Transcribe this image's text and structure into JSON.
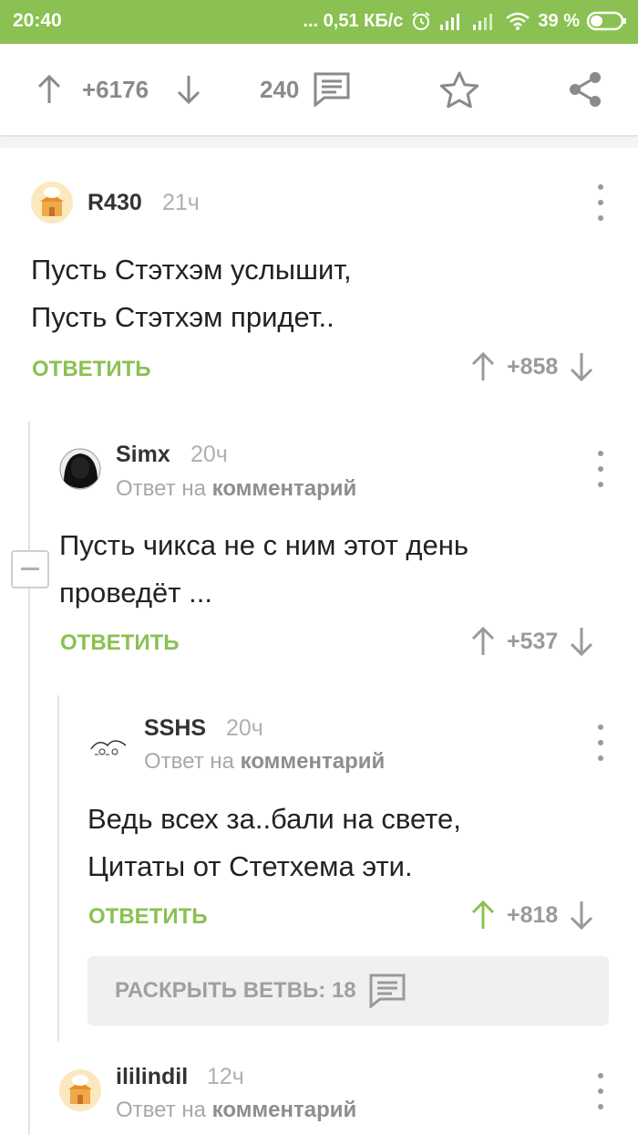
{
  "status_bar": {
    "time": "20:40",
    "network": "... 0,51 КБ/с",
    "battery": "39 %",
    "icons": [
      "alarm-icon",
      "signal-icon",
      "signal-icon",
      "wifi-icon",
      "battery-icon"
    ]
  },
  "post_toolbar": {
    "rating": "+6176",
    "comments_count": "240",
    "icons": [
      "arrow-up-icon",
      "arrow-down-icon",
      "comment-icon",
      "star-icon",
      "share-icon"
    ]
  },
  "comments": [
    {
      "author": "R430",
      "time": "21ч",
      "body": "Пусть Стэтхэм услышит,\nПусть Стэтхэм придет..",
      "reply_label": "ОТВЕТИТЬ",
      "rating": "+858"
    },
    {
      "author": "Simx",
      "time": "20ч",
      "reply_prefix": "Ответ на",
      "reply_target": "комментарий",
      "body": "Пусть чикса не с ним этот день\nпроведёт ...",
      "reply_label": "ОТВЕТИТЬ",
      "rating": "+537"
    },
    {
      "author": "SSHS",
      "time": "20ч",
      "reply_prefix": "Ответ на",
      "reply_target": "комментарий",
      "body": "Ведь всех за..бали на свете,\nЦитаты от Стетхема эти.",
      "reply_label": "ОТВЕТИТЬ",
      "rating": "+818",
      "upvoted": true
    },
    {
      "author": "ililindil",
      "time": "12ч",
      "reply_prefix": "Ответ на",
      "reply_target": "комментарий"
    }
  ],
  "expand_branch": {
    "label": "РАСКРЫТЬ ВЕТВЬ: 18"
  },
  "colors": {
    "accent": "#8ac152",
    "muted": "#9a9a9a"
  }
}
